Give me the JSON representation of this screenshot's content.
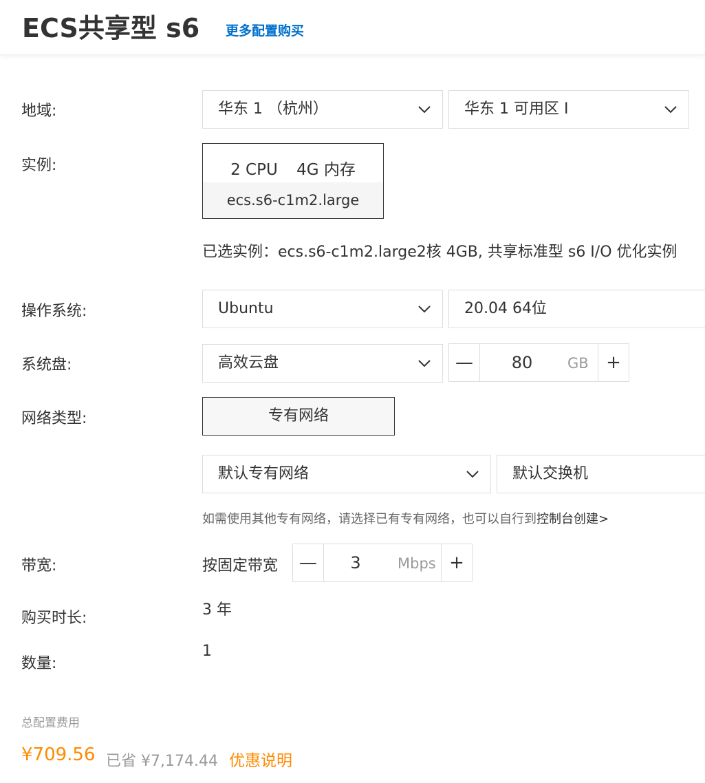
{
  "header": {
    "title": "ECS共享型 s6",
    "more_link": "更多配置购买"
  },
  "form": {
    "region": {
      "label": "地域:",
      "region_value": "华东 1 （杭州）",
      "zone_value": "华东 1 可用区 I"
    },
    "instance": {
      "label": "实例:",
      "cpu": "2 CPU",
      "memory": "4G 内存",
      "model": "ecs.s6-c1m2.large",
      "selected_text": "已选实例：ecs.s6-c1m2.large2核 4GB, 共享标准型 s6 I/O 优化实例"
    },
    "os": {
      "label": "操作系统:",
      "os_value": "Ubuntu",
      "version_value": "20.04 64位"
    },
    "disk": {
      "label": "系统盘:",
      "type_value": "高效云盘",
      "size": "80",
      "unit": "GB",
      "minus": "—",
      "plus": "+"
    },
    "network": {
      "label": "网络类型:",
      "type_button": "专有网络",
      "vpc_value": "默认专有网络",
      "vswitch_value": "默认交换机",
      "hint_prefix": "如需使用其他专有网络，请选择已有专有网络，也可以自行到",
      "hint_link": "控制台创建>"
    },
    "bandwidth": {
      "label": "带宽:",
      "type": "按固定带宽",
      "value": "3",
      "unit": "Mbps",
      "minus": "—",
      "plus": "+"
    },
    "duration": {
      "label": "购买时长:",
      "value": "3 年"
    },
    "quantity": {
      "label": "数量:",
      "value": "1"
    }
  },
  "footer": {
    "total_label": "总配置费用",
    "price": "¥709.56",
    "saved": "已省 ¥7,174.44",
    "promo_link": "优惠说明"
  },
  "colors": {
    "accent_link": "#0070cc",
    "price": "#ff8a00"
  },
  "icons": {
    "dropdown": "chevron-down-icon"
  }
}
